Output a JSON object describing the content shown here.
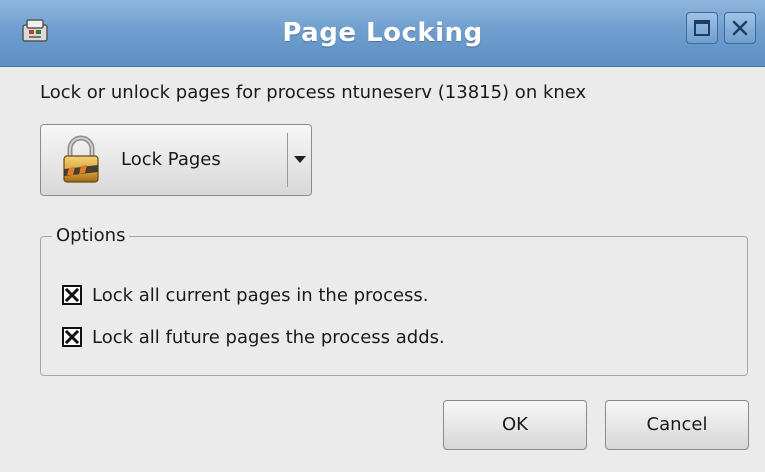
{
  "window": {
    "title": "Page Locking",
    "app_icon": "app-icon",
    "title_buttons": [
      "maximize-icon",
      "close-icon"
    ]
  },
  "description": "Lock or unlock pages for process ntuneserv (13815) on knex",
  "lock_button": {
    "label": "Lock Pages",
    "icon": "padlock-icon",
    "dropdown_icon": "chevron-down-icon"
  },
  "options": {
    "title": "Options",
    "items": [
      {
        "label": "Lock all current pages in the process.",
        "checked": true
      },
      {
        "label": "Lock all future pages the process adds.",
        "checked": true
      }
    ]
  },
  "buttons": {
    "ok": "OK",
    "cancel": "Cancel"
  },
  "colors": {
    "titlebar": "#6f9fcf",
    "window_bg": "#ebebeb"
  }
}
